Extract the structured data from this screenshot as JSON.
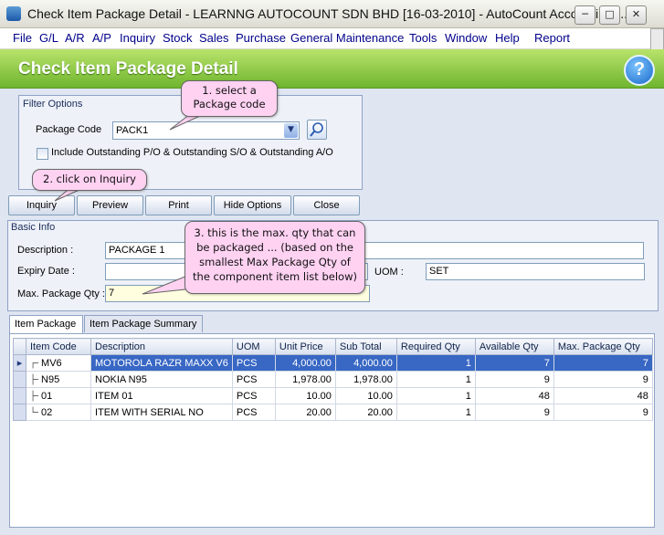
{
  "window": {
    "title": "Check Item Package Detail - LEARNNG AUTOCOUNT SDN BHD [16-03-2010] - AutoCount Accounting (...",
    "min_glyph": "─",
    "max_glyph": "□",
    "close_glyph": "✕"
  },
  "menu": {
    "items": [
      {
        "label": "File"
      },
      {
        "label": "G/L"
      },
      {
        "label": "A/R"
      },
      {
        "label": "A/P"
      },
      {
        "label": "Inquiry"
      },
      {
        "label": "Stock"
      },
      {
        "label": "Sales"
      },
      {
        "label": "Purchase"
      },
      {
        "label": "General Maintenance"
      },
      {
        "label": "Tools"
      },
      {
        "label": "Window"
      },
      {
        "label": "Help"
      },
      {
        "label": "Report"
      }
    ]
  },
  "header": {
    "title": "Check Item Package Detail",
    "help_glyph": "?"
  },
  "filter": {
    "group_label": "Filter Options",
    "package_code_label": "Package Code",
    "package_code_value": "PACK1",
    "include_outstanding_label": "Include Outstanding P/O & Outstanding S/O & Outstanding A/O"
  },
  "toolbar": {
    "inquiry": "Inquiry",
    "preview": "Preview",
    "print": "Print",
    "hide_options": "Hide Options",
    "close": "Close"
  },
  "basic_info": {
    "group_label": "Basic Info",
    "description_label": "Description :",
    "description_value": "PACKAGE 1",
    "expiry_label": "Expiry Date :",
    "expiry_value": "",
    "uom_label": "UOM :",
    "uom_value": "SET",
    "max_qty_label": "Max. Package Qty :",
    "max_qty_value": "7"
  },
  "callouts": {
    "c1_line1": "1. select a",
    "c1_line2": "Package code",
    "c2": "2. click on Inquiry",
    "c3_line1": "3. this is the max. qty that can",
    "c3_line2": "be packaged ... (based on the",
    "c3_line3": "smallest Max Package Qty of",
    "c3_line4": "the component item list below)"
  },
  "tabs": [
    {
      "label": "Item Package"
    },
    {
      "label": "Item Package Summary"
    }
  ],
  "grid": {
    "columns": [
      "Item Code",
      "Description",
      "UOM",
      "Unit Price",
      "Sub Total",
      "Required Qty",
      "Available Qty",
      "Max. Package Qty"
    ],
    "rows": [
      {
        "code": "MV6",
        "description": "MOTOROLA RAZR MAXX V6",
        "uom": "PCS",
        "unit_price": "4,000.00",
        "sub_total": "4,000.00",
        "required_qty": "1",
        "available_qty": "7",
        "max_package_qty": "7"
      },
      {
        "code": "N95",
        "description": "NOKIA N95",
        "uom": "PCS",
        "unit_price": "1,978.00",
        "sub_total": "1,978.00",
        "required_qty": "1",
        "available_qty": "9",
        "max_package_qty": "9"
      },
      {
        "code": "01",
        "description": "ITEM 01",
        "uom": "PCS",
        "unit_price": "10.00",
        "sub_total": "10.00",
        "required_qty": "1",
        "available_qty": "48",
        "max_package_qty": "48"
      },
      {
        "code": "02",
        "description": "ITEM WITH SERIAL NO",
        "uom": "PCS",
        "unit_price": "20.00",
        "sub_total": "20.00",
        "required_qty": "1",
        "available_qty": "9",
        "max_package_qty": "9"
      }
    ],
    "current_row_indicator": "▸"
  }
}
